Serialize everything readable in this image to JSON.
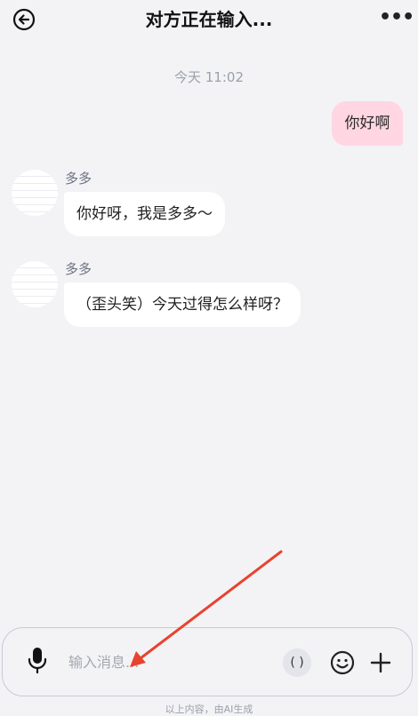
{
  "header": {
    "title": "对方正在输入...",
    "back_icon": "back-arrow-circle-icon",
    "more_icon": "more-dots-icon",
    "more_glyph": "•••"
  },
  "chat": {
    "timestamp": "今天 11:02",
    "messages": [
      {
        "from": "me",
        "text": "你好啊"
      },
      {
        "from": "bot",
        "sender": "多多",
        "text": "你好呀，我是多多～"
      },
      {
        "from": "bot",
        "sender": "多多",
        "text": "（歪头笑）今天过得怎么样呀？"
      }
    ]
  },
  "input_bar": {
    "placeholder": "输入消息...",
    "paren_label": "( )",
    "mic_icon": "microphone-icon",
    "emoji_icon": "smiley-icon",
    "plus_icon": "plus-icon"
  },
  "footer": {
    "disclaimer": "以上内容，由AI生成"
  },
  "colors": {
    "background": "#f3f3f5",
    "my_bubble": "#ffd6e2",
    "bot_bubble": "#ffffff",
    "annotation_arrow": "#e8432e"
  }
}
